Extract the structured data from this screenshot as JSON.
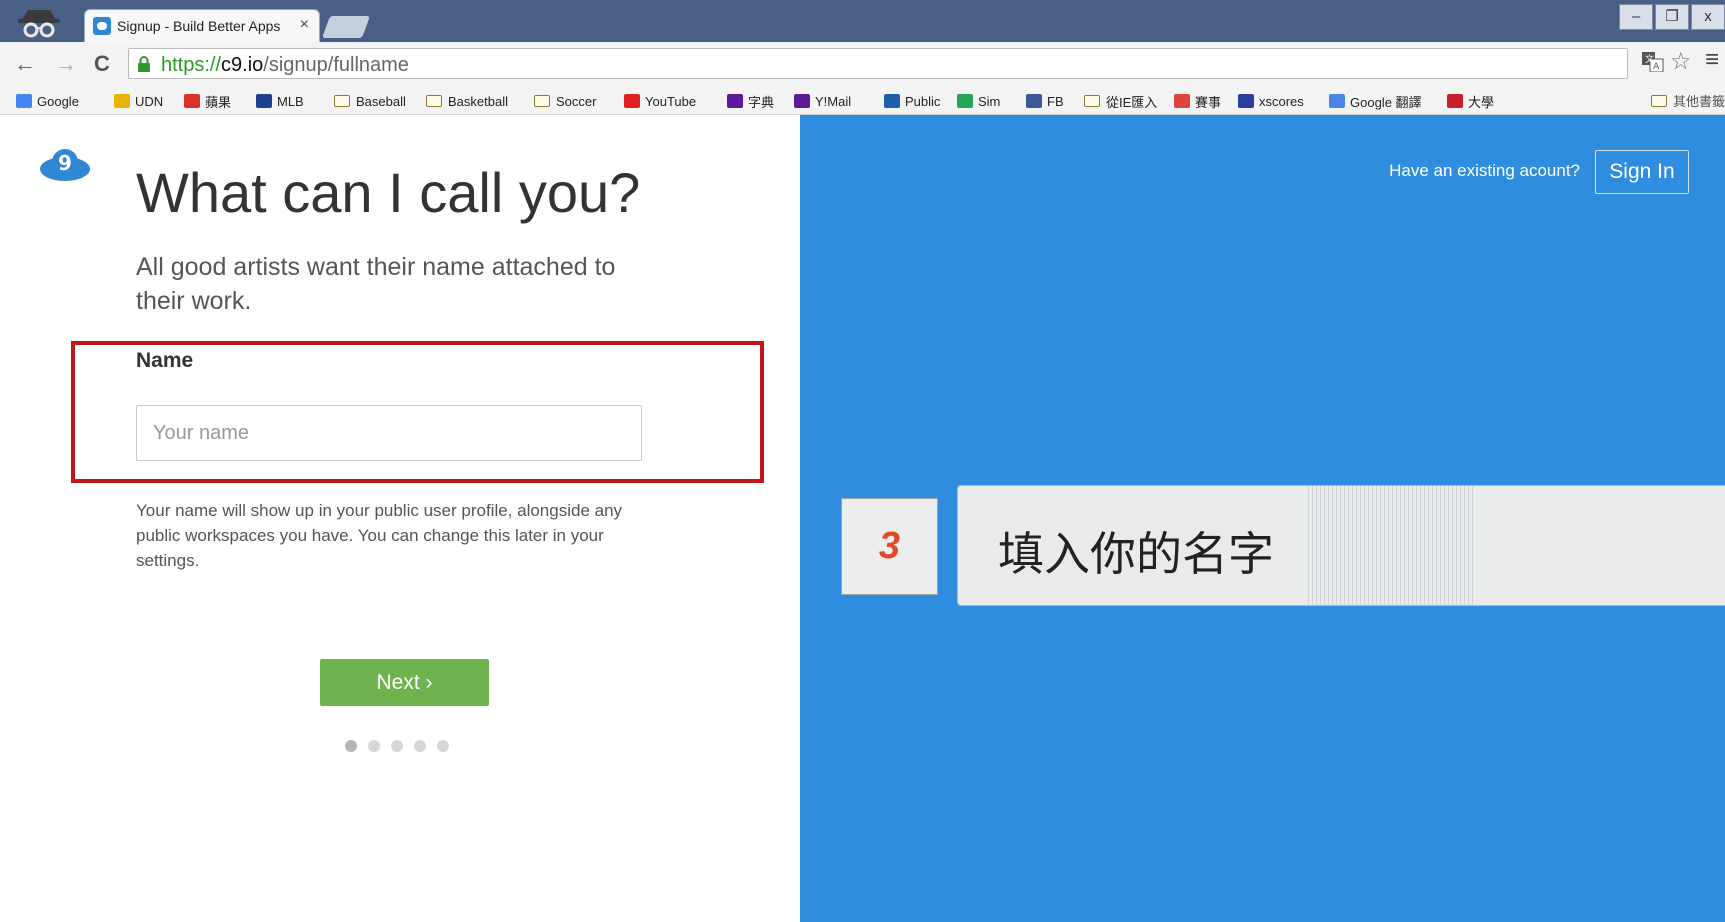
{
  "browser": {
    "tab_title": "Signup - Build Better Apps",
    "tab_close": "×",
    "url": {
      "scheme": "https://",
      "host": "c9.io",
      "path": "/signup/fullname"
    },
    "window_buttons": [
      "–",
      "❐",
      "x"
    ]
  },
  "bookmarks": {
    "items": [
      {
        "label": "Google",
        "icon": "google-icon",
        "color": "#4285f4"
      },
      {
        "label": "UDN",
        "icon": "udn-icon",
        "color": "#e8b400"
      },
      {
        "label": "蘋果",
        "icon": "apple-icon",
        "color": "#d8342c"
      },
      {
        "label": "MLB",
        "icon": "mlb-icon",
        "color": "#1d3f8c"
      },
      {
        "label": "Baseball",
        "icon": "folder-icon"
      },
      {
        "label": "Basketball",
        "icon": "folder-icon"
      },
      {
        "label": "Soccer",
        "icon": "folder-icon"
      },
      {
        "label": "YouTube",
        "icon": "youtube-icon",
        "color": "#e02020"
      },
      {
        "label": "字典",
        "icon": "yahoo-icon",
        "color": "#5c1a9a"
      },
      {
        "label": "Y!Mail",
        "icon": "yahoo-icon",
        "color": "#5c1a9a"
      },
      {
        "label": "Public",
        "icon": "cloud-icon",
        "color": "#1f5fa8"
      },
      {
        "label": "Sim",
        "icon": "sim-icon",
        "color": "#25a45a"
      },
      {
        "label": "FB",
        "icon": "facebook-icon",
        "color": "#3b5998"
      },
      {
        "label": "從IE匯入",
        "icon": "folder-icon"
      },
      {
        "label": "賽事",
        "icon": "sports-icon",
        "color": "#e0443a"
      },
      {
        "label": "xscores",
        "icon": "xscores-icon",
        "color": "#2a3fa0"
      },
      {
        "label": "Google 翻譯",
        "icon": "translate-icon",
        "color": "#4a86e8"
      },
      {
        "label": "大學",
        "icon": "university-icon",
        "color": "#c8202a"
      }
    ],
    "other": "其他書籤"
  },
  "page": {
    "headline": "What can I call you?",
    "subline": "All good artists want their name attached to their work.",
    "name_label": "Name",
    "name_placeholder": "Your name",
    "help_text": "Your name will show up in your public user profile, alongside any public workspaces you have. You can change this later in your settings.",
    "next_label": "Next ›",
    "steps_total": 5,
    "step_current": 1,
    "existing_prompt": "Have an existing acount?",
    "signin_label": "Sign In"
  },
  "annotation": {
    "step_number": "3",
    "text": "填入你的名字"
  },
  "colors": {
    "tabstrip": "#4a5f86",
    "right_panel": "#2e8ddf",
    "next_button": "#6fb34f",
    "highlight_box": "#c0161b",
    "step_number": "#e0492c"
  }
}
